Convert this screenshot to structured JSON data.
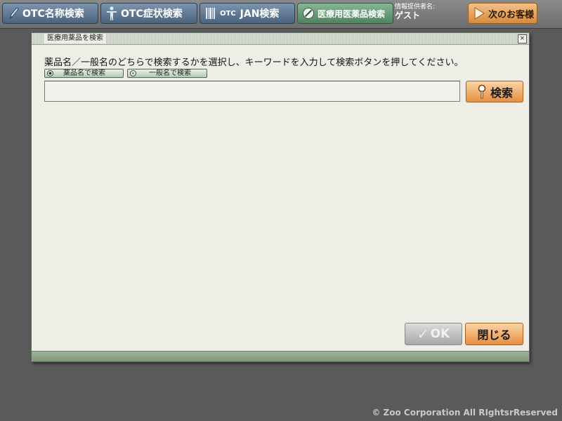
{
  "toolbar": {
    "otc_name_search": "OTC名称検索",
    "otc_symptom_search": "OTC症状検索",
    "otc_jan_prefix": "OTC",
    "otc_jan_search": "JAN検索",
    "medical_drug_search": "医療用医薬品検索",
    "user_label": "情報提供者名:",
    "user_name": "ゲスト",
    "next_customer": "次のお客様"
  },
  "dialog": {
    "title": "医療用薬品を検索",
    "close_glyph": "×",
    "instruction": "薬品名／一般名のどちらで検索するかを選択し、キーワードを入力して検索ボタンを押してください。",
    "radio_drug_name": "薬品名で検索",
    "radio_generic_name": "一般名で検索",
    "search_value": "",
    "search_button": "検索",
    "ok_button": "OK",
    "close_button": "閉じる"
  },
  "footer": {
    "copyright": "© Zoo Corporation All RIghtsrReserved"
  },
  "colors": {
    "toolbar_button_blue": "#5b7592",
    "toolbar_button_green": "#5f9470",
    "accent_orange": "#e68f3f",
    "dialog_background": "#eeeee6",
    "page_background": "#5a5a5a"
  },
  "icons": {
    "otc_name_search": "pen-icon",
    "otc_symptom_search": "human-figure-icon",
    "otc_jan_search": "barcode-icon",
    "medical_drug_search": "pill-icon",
    "next_customer": "play-arrow-icon",
    "search": "search-key-icon",
    "ok": "checkmark-icon",
    "close": "close-icon"
  }
}
